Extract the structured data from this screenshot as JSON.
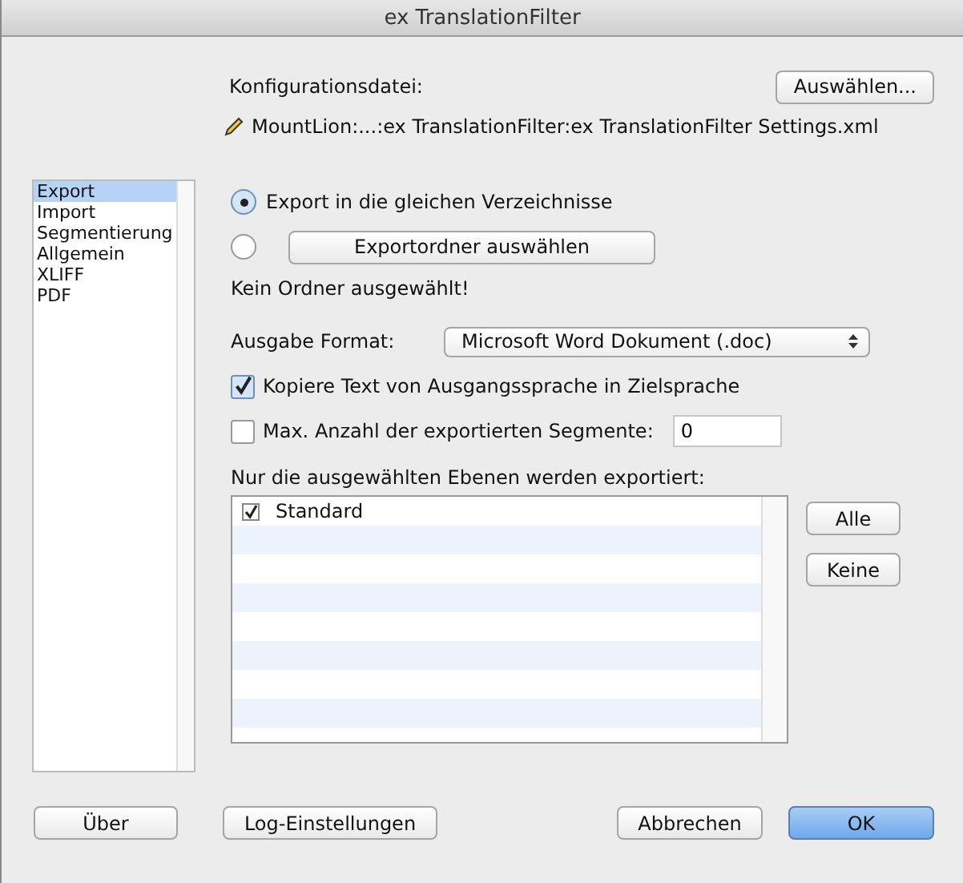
{
  "window": {
    "title": "ex TranslationFilter"
  },
  "config": {
    "label": "Konfigurationsdatei:",
    "choose_button": "Auswählen...",
    "path": "MountLion:...:ex TranslationFilter:ex TranslationFilter Settings.xml"
  },
  "sidebar": {
    "items": [
      {
        "label": "Export",
        "selected": true
      },
      {
        "label": "Import",
        "selected": false
      },
      {
        "label": "Segmentierung",
        "selected": false
      },
      {
        "label": "Allgemein",
        "selected": false
      },
      {
        "label": "XLIFF",
        "selected": false
      },
      {
        "label": "PDF",
        "selected": false
      }
    ]
  },
  "export_options": [
    {
      "kind": "label",
      "label": "Export in die gleichen Verzeichnisse",
      "selected": true
    },
    {
      "kind": "button",
      "label": "Exportordner auswählen",
      "selected": false
    }
  ],
  "folder_status": "Kein Ordner ausgewählt!",
  "format": {
    "label": "Ausgabe Format:",
    "value": "Microsoft Word Dokument (.doc)"
  },
  "copy_source": {
    "label": "Kopiere Text von Ausgangssprache in Zielsprache",
    "checked": true
  },
  "max_segments": {
    "label": "Max. Anzahl der exportierten Segmente:",
    "checked": false,
    "value": "0"
  },
  "layers": {
    "label": "Nur die ausgewählten Ebenen werden exportiert:",
    "items": [
      {
        "label": "Standard",
        "checked": true
      }
    ],
    "buttons": [
      "Alle",
      "Keine"
    ]
  },
  "footer": {
    "left": [
      "Über",
      "Log-Einstellungen"
    ],
    "right": [
      {
        "label": "Abbrechen",
        "default": false
      },
      {
        "label": "OK",
        "default": true
      }
    ]
  }
}
